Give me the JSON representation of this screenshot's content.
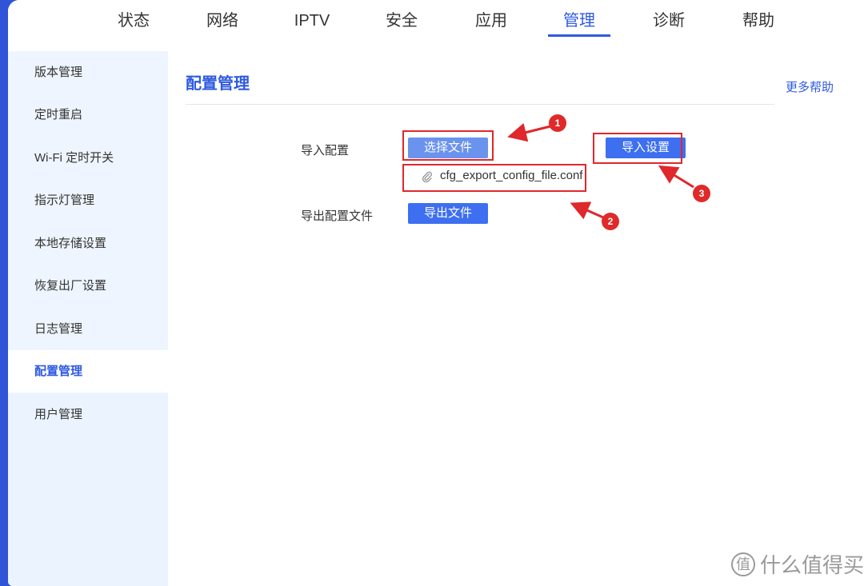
{
  "nav": {
    "items": [
      {
        "label": "状态"
      },
      {
        "label": "网络"
      },
      {
        "label": "IPTV"
      },
      {
        "label": "安全"
      },
      {
        "label": "应用"
      },
      {
        "label": "管理"
      },
      {
        "label": "诊断"
      },
      {
        "label": "帮助"
      }
    ],
    "active": "管理"
  },
  "sidebar": {
    "items": [
      {
        "label": "版本管理"
      },
      {
        "label": "定时重启"
      },
      {
        "label": "Wi-Fi 定时开关"
      },
      {
        "label": "指示灯管理"
      },
      {
        "label": "本地存储设置"
      },
      {
        "label": "恢复出厂设置"
      },
      {
        "label": "日志管理"
      },
      {
        "label": "配置管理"
      },
      {
        "label": "用户管理"
      }
    ],
    "active": "配置管理"
  },
  "main": {
    "title": "配置管理",
    "help_link": "更多帮助",
    "import_label": "导入配置",
    "choose_file_button": "选择文件",
    "import_settings_button": "导入设置",
    "selected_file": "cfg_export_config_file.conf",
    "export_label": "导出配置文件",
    "export_button": "导出文件"
  },
  "annotations": {
    "badge_1": "1",
    "badge_2": "2",
    "badge_3": "3",
    "color": "#e0272c"
  },
  "watermark": {
    "icon": "值",
    "text": "什么值得买"
  },
  "colors": {
    "accent": "#2f5ae0",
    "button": "#3d6ff0",
    "sidebar_bg": "#eef5fe",
    "frame_bg": "#2f54d8"
  }
}
